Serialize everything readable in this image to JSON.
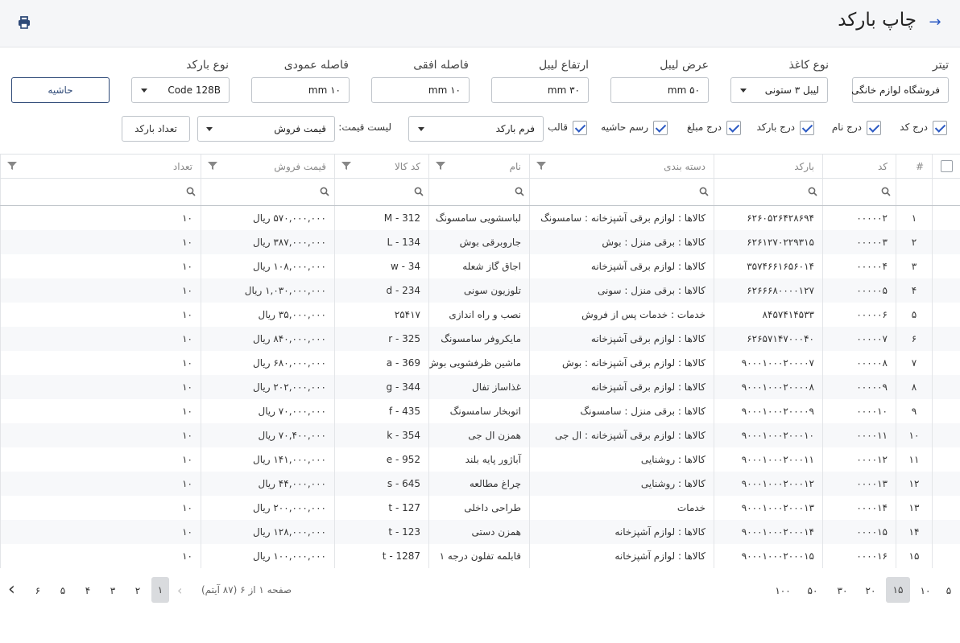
{
  "header": {
    "title": "چاپ بارکد",
    "back_icon": "arrow-right-icon",
    "print_icon": "printer-icon"
  },
  "form": {
    "title_label": "تیتر",
    "title_value": "فروشگاه لوازم خانگی",
    "paper_label": "نوع کاغذ",
    "paper_value": "لیبل ۳ ستونی",
    "label_width_label": "عرض لیبل",
    "label_width_value": "۵۰ mm",
    "label_height_label": "ارتفاع لیبل",
    "label_height_value": "۳۰ mm",
    "hgap_label": "فاصله افقی",
    "hgap_value": "۱۰ mm",
    "vgap_label": "فاصله عمودی",
    "vgap_value": "۱۰ mm",
    "barcode_type_label": "نوع بارکد",
    "barcode_type_value": "Code 128B",
    "margin_button": "حاشیه"
  },
  "options": {
    "insert_code": "درج کد",
    "insert_name": "درج نام",
    "insert_barcode": "درج بارکد",
    "insert_amount": "درج مبلغ",
    "draw_border": "رسم حاشیه",
    "template_label": "قالب",
    "template_value": "فرم بارکد",
    "price_list_label": "لیست قیمت:",
    "price_list_value": "قیمت فروش",
    "barcode_count_button": "تعداد بارکد"
  },
  "table": {
    "headers": {
      "num": "#",
      "code": "کد",
      "barcode": "بارکد",
      "category": "دسته بندی",
      "name": "نام",
      "item_code": "کد کالا",
      "price": "قیمت فروش",
      "qty": "تعداد"
    },
    "rows": [
      {
        "num": "۱",
        "code": "۰۰۰۰۰۲",
        "barcode": "۶۲۶۰۵۲۶۴۲۸۶۹۴",
        "category": "کالاها : لوازم برقی آشپزخانه : سامسونگ",
        "name": "لباسشویی سامسونگ",
        "item_code": "M - 312",
        "price": "۵۷۰,۰۰۰,۰۰۰ ریال",
        "qty": "۱۰"
      },
      {
        "num": "۲",
        "code": "۰۰۰۰۰۳",
        "barcode": "۶۲۶۱۲۷۰۲۲۹۳۱۵",
        "category": "کالاها : برقی منزل : بوش",
        "name": "جاروبرقی بوش",
        "item_code": "L - 134",
        "price": "۳۸۷,۰۰۰,۰۰۰ ریال",
        "qty": "۱۰"
      },
      {
        "num": "۳",
        "code": "۰۰۰۰۰۴",
        "barcode": "۳۵۷۴۶۶۱۶۵۶۰۱۴",
        "category": "کالاها : لوازم برقی آشپزخانه",
        "name": "اجاق گاز شعله",
        "item_code": "w - 34",
        "price": "۱۰۸,۰۰۰,۰۰۰ ریال",
        "qty": "۱۰"
      },
      {
        "num": "۴",
        "code": "۰۰۰۰۰۵",
        "barcode": "۶۲۶۶۶۸۰۰۰۰۱۲۷",
        "category": "کالاها : برقی منزل : سونی",
        "name": "تلوزیون سونی",
        "item_code": "d - 234",
        "price": "۱,۰۳۰,۰۰۰,۰۰۰ ریال",
        "qty": "۱۰"
      },
      {
        "num": "۵",
        "code": "۰۰۰۰۰۶",
        "barcode": "۸۴۵۷۴۱۴۵۳۳",
        "category": "خدمات : خدمات پس از فروش",
        "name": "نصب و راه اندازی",
        "item_code": "۲۵۴۱۷",
        "price": "۳۵,۰۰۰,۰۰۰ ریال",
        "qty": "۱۰"
      },
      {
        "num": "۶",
        "code": "۰۰۰۰۰۷",
        "barcode": "۶۲۶۵۷۱۴۷۰۰۰۴۰",
        "category": "کالاها : لوازم برقی آشپزخانه",
        "name": "مایکروفر سامسونگ",
        "item_code": "r - 325",
        "price": "۸۴۰,۰۰۰,۰۰۰ ریال",
        "qty": "۱۰"
      },
      {
        "num": "۷",
        "code": "۰۰۰۰۰۸",
        "barcode": "۹۰۰۰۱۰۰۰۲۰۰۰۰۷",
        "category": "کالاها : لوازم برقی آشپزخانه : بوش",
        "name": "ماشین ظرفشویی بوش",
        "item_code": "a - 369",
        "price": "۶۸۰,۰۰۰,۰۰۰ ریال",
        "qty": "۱۰"
      },
      {
        "num": "۸",
        "code": "۰۰۰۰۰۹",
        "barcode": "۹۰۰۰۱۰۰۰۲۰۰۰۰۸",
        "category": "کالاها : لوازم برقی آشپزخانه",
        "name": "غذاساز تفال",
        "item_code": "g - 344",
        "price": "۲۰۲,۰۰۰,۰۰۰ ریال",
        "qty": "۱۰"
      },
      {
        "num": "۹",
        "code": "۰۰۰۰۱۰",
        "barcode": "۹۰۰۰۱۰۰۰۲۰۰۰۰۹",
        "category": "کالاها : برقی منزل : سامسونگ",
        "name": "اتوبخار سامسونگ",
        "item_code": "f - 435",
        "price": "۷۰,۰۰۰,۰۰۰ ریال",
        "qty": "۱۰"
      },
      {
        "num": "۱۰",
        "code": "۰۰۰۰۱۱",
        "barcode": "۹۰۰۰۱۰۰۰۲۰۰۰۱۰",
        "category": "کالاها : لوازم برقی آشپزخانه : ال جی",
        "name": "همزن ال جی",
        "item_code": "k - 354",
        "price": "۷۰,۴۰۰,۰۰۰ ریال",
        "qty": "۱۰"
      },
      {
        "num": "۱۱",
        "code": "۰۰۰۰۱۲",
        "barcode": "۹۰۰۰۱۰۰۰۲۰۰۰۱۱",
        "category": "کالاها : روشنایی",
        "name": "آباژور پایه بلند",
        "item_code": "e - 952",
        "price": "۱۴۱,۰۰۰,۰۰۰ ریال",
        "qty": "۱۰"
      },
      {
        "num": "۱۲",
        "code": "۰۰۰۰۱۳",
        "barcode": "۹۰۰۰۱۰۰۰۲۰۰۰۱۲",
        "category": "کالاها : روشنایی",
        "name": "چراغ مطالعه",
        "item_code": "s - 645",
        "price": "۴۴,۰۰۰,۰۰۰ ریال",
        "qty": "۱۰"
      },
      {
        "num": "۱۳",
        "code": "۰۰۰۰۱۴",
        "barcode": "۹۰۰۰۱۰۰۰۲۰۰۰۱۳",
        "category": "خدمات",
        "name": "طراحی داخلی",
        "item_code": "t - 127",
        "price": "۲۰۰,۰۰۰,۰۰۰ ریال",
        "qty": "۱۰"
      },
      {
        "num": "۱۴",
        "code": "۰۰۰۰۱۵",
        "barcode": "۹۰۰۰۱۰۰۰۲۰۰۰۱۴",
        "category": "کالاها : لوازم آشپزخانه",
        "name": "همزن دستی",
        "item_code": "t - 123",
        "price": "۱۲۸,۰۰۰,۰۰۰ ریال",
        "qty": "۱۰"
      },
      {
        "num": "۱۵",
        "code": "۰۰۰۰۱۶",
        "barcode": "۹۰۰۰۱۰۰۰۲۰۰۰۱۵",
        "category": "کالاها : لوازم آشپزخانه",
        "name": "قابلمه تفلون درجه ۱",
        "item_code": "t - 1287",
        "price": "۱۰۰,۰۰۰,۰۰۰ ریال",
        "qty": "۱۰"
      }
    ]
  },
  "pager": {
    "info": "صفحه ۱ از ۶ (۸۷ آیتم)",
    "pages": [
      "۱",
      "۲",
      "۳",
      "۴",
      "۵",
      "۶"
    ],
    "sizes": [
      "۵",
      "۱۰",
      "۱۵",
      "۲۰",
      "۳۰",
      "۵۰",
      "۱۰۰"
    ],
    "active_page": "۱",
    "active_size": "۱۵"
  }
}
